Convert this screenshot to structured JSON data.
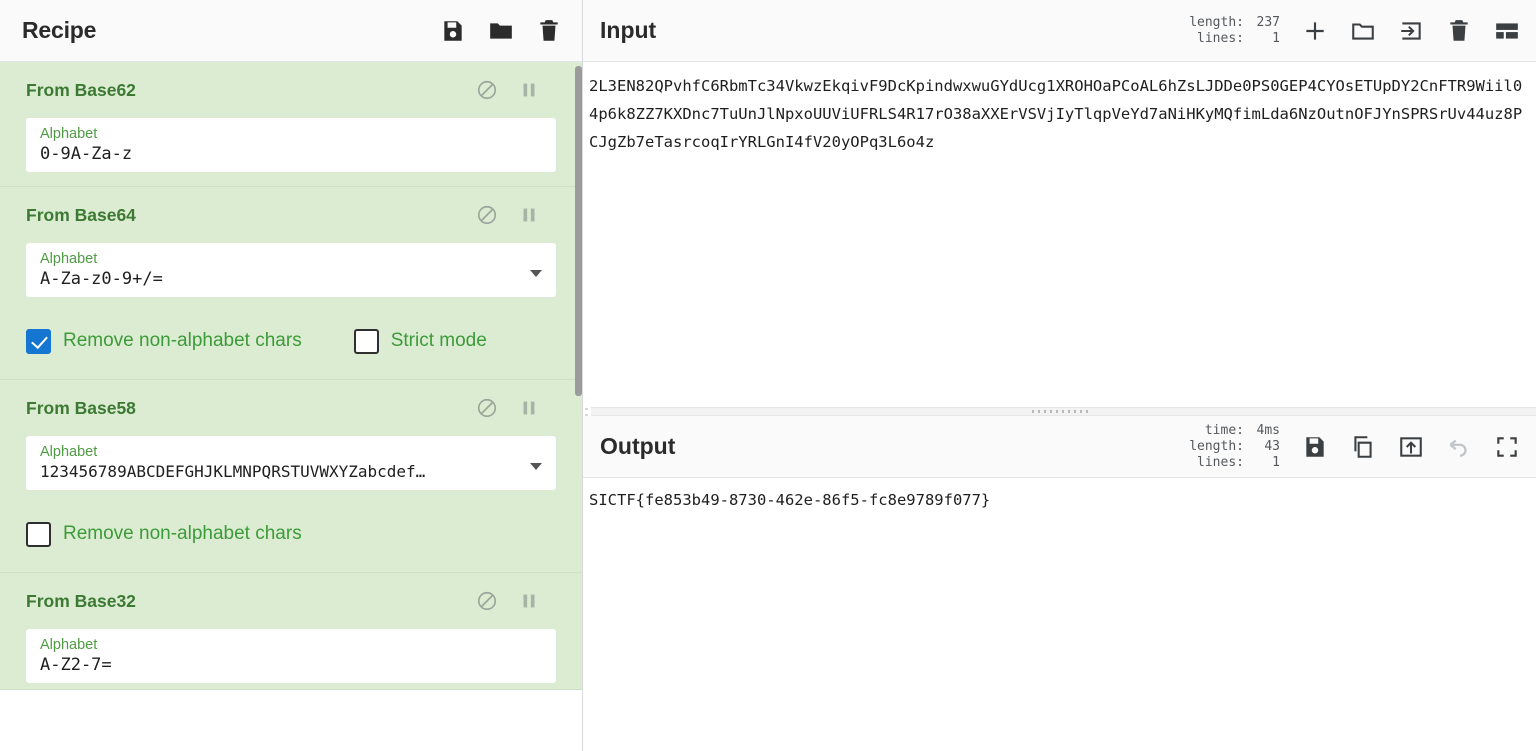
{
  "recipe": {
    "title": "Recipe",
    "title_icons": [
      {
        "name": "save-recipe-icon",
        "glyph": "floppy"
      },
      {
        "name": "load-recipe-icon",
        "glyph": "folder"
      },
      {
        "name": "clear-recipe-icon",
        "glyph": "trash"
      }
    ],
    "operations": [
      {
        "name": "From Base62",
        "arg_label": "Alphabet",
        "arg_value": "0-9A-Za-z",
        "has_dropdown": false,
        "checkboxes": []
      },
      {
        "name": "From Base64",
        "arg_label": "Alphabet",
        "arg_value": "A-Za-z0-9+/=",
        "has_dropdown": true,
        "checkboxes": [
          {
            "label": "Remove non-alphabet chars",
            "checked": true
          },
          {
            "label": "Strict mode",
            "checked": false
          }
        ]
      },
      {
        "name": "From Base58",
        "arg_label": "Alphabet",
        "arg_value": "123456789ABCDEFGHJKLMNPQRSTUVWXYZabcdef…",
        "has_dropdown": true,
        "checkboxes": [
          {
            "label": "Remove non-alphabet chars",
            "checked": false
          }
        ]
      },
      {
        "name": "From Base32",
        "arg_label": "Alphabet",
        "arg_value": "A-Z2-7=",
        "has_dropdown": false,
        "checkboxes": []
      }
    ]
  },
  "input": {
    "title": "Input",
    "meta": [
      {
        "key": "length:",
        "value": "237"
      },
      {
        "key": "lines:",
        "value": "1"
      }
    ],
    "icons": [
      {
        "name": "add-input-tab-icon",
        "glyph": "plus"
      },
      {
        "name": "open-folder-icon",
        "glyph": "folder-outline"
      },
      {
        "name": "open-file-icon",
        "glyph": "arrow-into-box"
      },
      {
        "name": "clear-input-icon",
        "glyph": "trash"
      },
      {
        "name": "tabs-layout-icon",
        "glyph": "grid"
      }
    ],
    "text": "2L3EN82QPvhfC6RbmTc34VkwzEkqivF9DcKpindwxwuGYdUcg1XROHOaPCoAL6hZsLJDDe0PS0GEP4CYOsETUpDY2CnFTR9Wiil04p6k8ZZ7KXDnc7TuUnJlNpxoUUViUFRLS4R17rO38aXXErVSVjIyTlqpVeYd7aNiHKyMQfimLda6NzOutnOFJYnSPRSrUv44uz8PCJgZb7eTasrcoqIrYRLGnI4fV20yOPq3L6o4z"
  },
  "output": {
    "title": "Output",
    "meta": [
      {
        "key": "time:",
        "value": "4ms"
      },
      {
        "key": "length:",
        "value": "43"
      },
      {
        "key": "lines:",
        "value": "1"
      }
    ],
    "icons": [
      {
        "name": "save-output-icon",
        "glyph": "floppy"
      },
      {
        "name": "copy-output-icon",
        "glyph": "copy"
      },
      {
        "name": "replace-input-icon",
        "glyph": "arrow-up-box"
      },
      {
        "name": "undo-bake-icon",
        "glyph": "undo"
      },
      {
        "name": "maximise-output-icon",
        "glyph": "maximise"
      }
    ],
    "text": "SICTF{fe853b49-8730-462e-86f5-fc8e9789f077}"
  },
  "colors": {
    "op_bg": "#dcecd2",
    "op_title": "#3c7a33",
    "checkbox_on": "#1476d1",
    "label_green": "#4f9b43"
  }
}
